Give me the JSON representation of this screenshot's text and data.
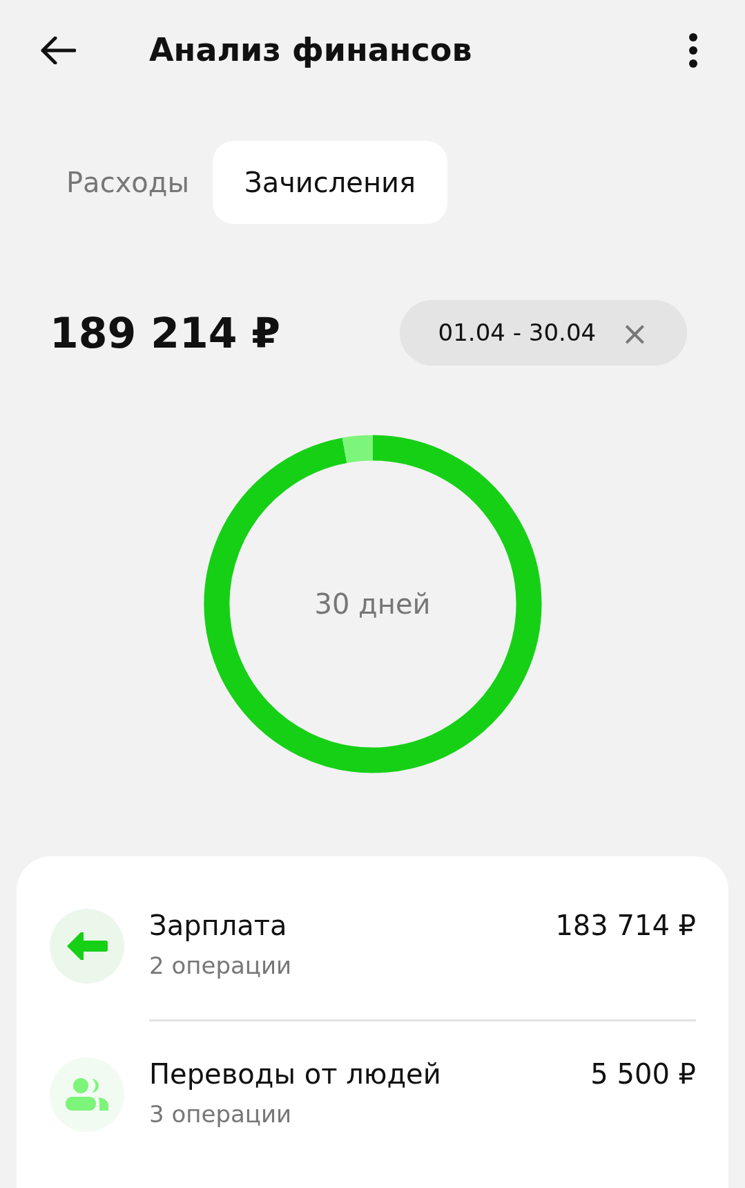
{
  "header": {
    "title": "Анализ финансов"
  },
  "tabs": [
    {
      "label": "Расходы",
      "selected": false
    },
    {
      "label": "Зачисления",
      "selected": true
    }
  ],
  "total": "189 214 ₽",
  "period": {
    "label": "01.04 - 30.04",
    "clear": "×"
  },
  "chart": {
    "center_label": "30 дней"
  },
  "items": [
    {
      "kind": "salary",
      "title": "Зарплата",
      "subtitle": "2 операции",
      "amount": "183 714 ₽",
      "color": "#16d016"
    },
    {
      "kind": "people",
      "title": "Переводы от людей",
      "subtitle": "3 операции",
      "amount": "5 500 ₽",
      "color": "#7df47a"
    }
  ]
}
